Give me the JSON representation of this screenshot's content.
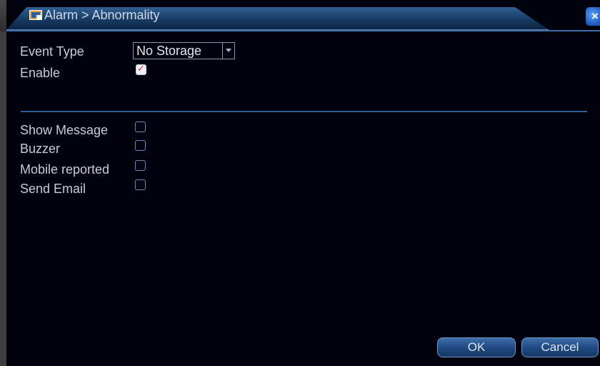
{
  "window": {
    "title": "Alarm > Abnormality"
  },
  "form": {
    "event_type_label": "Event Type",
    "event_type_value": "No Storage",
    "enable_label": "Enable",
    "enable_checked": true
  },
  "actions": [
    {
      "label": "Show Message",
      "checked": false
    },
    {
      "label": "Buzzer",
      "checked": false
    },
    {
      "label": "Mobile reported",
      "checked": false
    },
    {
      "label": "Send Email",
      "checked": false
    }
  ],
  "buttons": {
    "ok": "OK",
    "cancel": "Cancel"
  },
  "icons": {
    "title": "window-icon",
    "close": "close-icon",
    "dropdown": "chevron-down-icon",
    "check": "check-icon"
  },
  "colors": {
    "background": "#02020e",
    "accent": "#2f5c96",
    "check": "#e0301e"
  }
}
